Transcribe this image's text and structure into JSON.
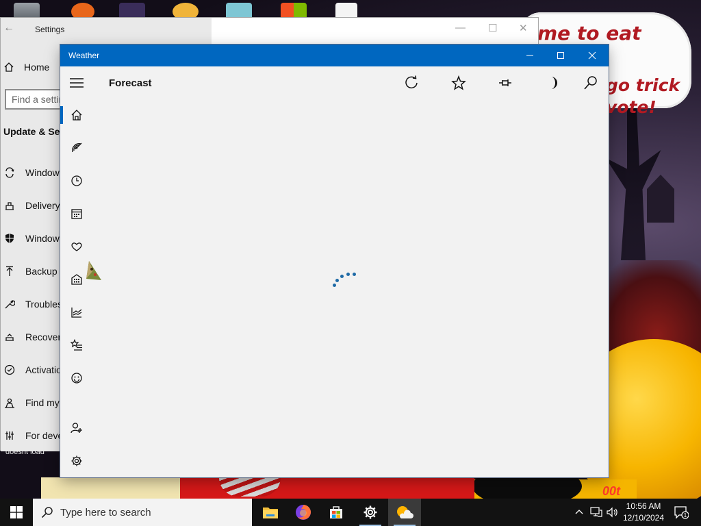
{
  "wallpaper": {
    "bubble_lines": [
      "me to eat shit",
      "go trick",
      "vote!"
    ],
    "caption": "doesnt load",
    "sign": "00t"
  },
  "settings": {
    "title": "Settings",
    "home_label": "Home",
    "search_placeholder": "Find a setting",
    "section_title": "Update & Security",
    "nav_items": [
      {
        "label": "Windows Update",
        "icon": "sync-icon"
      },
      {
        "label": "Delivery Optimization",
        "icon": "delivery-icon"
      },
      {
        "label": "Windows Security",
        "icon": "shield-icon"
      },
      {
        "label": "Backup",
        "icon": "backup-icon"
      },
      {
        "label": "Troubleshoot",
        "icon": "wrench-icon"
      },
      {
        "label": "Recovery",
        "icon": "recovery-icon"
      },
      {
        "label": "Activation",
        "icon": "check-circle-icon"
      },
      {
        "label": "Find my device",
        "icon": "person-pin-icon"
      },
      {
        "label": "For developers",
        "icon": "developer-icon"
      }
    ]
  },
  "weather": {
    "title": "Weather",
    "page_title": "Forecast",
    "header_buttons": [
      "refresh-icon",
      "favorite-star-icon",
      "pin-icon",
      "dark-mode-moon-icon",
      "search-icon"
    ],
    "nav": [
      "home-icon",
      "radar-icon",
      "clock-icon",
      "calendar-icon",
      "heart-leaf-icon",
      "building-icon",
      "chart-icon",
      "star-list-icon",
      "smiley-icon",
      "add-user-icon",
      "settings-gear-icon"
    ],
    "loading": true
  },
  "taskbar": {
    "search_placeholder": "Type here to search",
    "apps": [
      "file-explorer",
      "firefox",
      "microsoft-store",
      "settings",
      "weather"
    ],
    "time": "10:56 AM",
    "date": "12/10/2024",
    "notification_count": "1"
  },
  "colors": {
    "accent": "#0067c0",
    "taskbar": "#121212",
    "weather_bg": "#f2f2f2"
  }
}
